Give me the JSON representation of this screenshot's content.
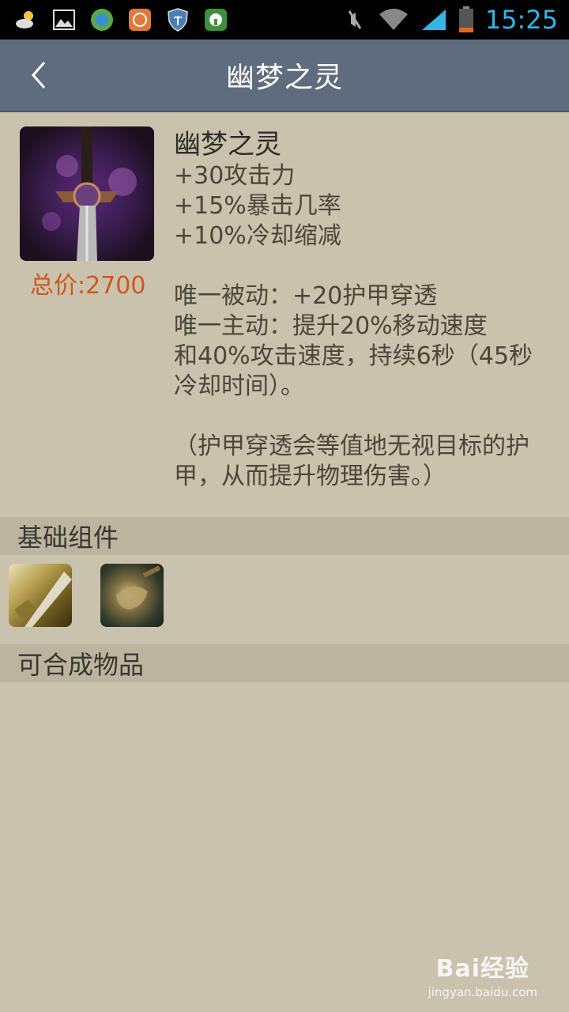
{
  "status_bar": {
    "time": "15:25",
    "icons": [
      "weather-icon",
      "gallery-icon",
      "browser-icon",
      "lock-app-icon",
      "shield-icon",
      "security-app-icon",
      "mute-icon",
      "wifi-icon",
      "signal-icon",
      "battery-icon"
    ]
  },
  "header": {
    "title": "幽梦之灵"
  },
  "item": {
    "name": "幽梦之灵",
    "stats": [
      "+30攻击力",
      "+15%暴击几率",
      "+10%冷却缩减"
    ],
    "passive": "唯一被动：+20护甲穿透",
    "active_lines": [
      "唯一主动：提升20%移动速度",
      "和40%攻击速度，持续6秒（45秒",
      "冷却时间）。"
    ],
    "note_lines": [
      "（护甲穿透会等值地无视目标的护",
      "甲，从而提升物理伤害。）"
    ],
    "price": "总价:2700"
  },
  "sections": {
    "components_label": "基础组件",
    "builds_into_label": "可合成物品"
  },
  "components": [
    "long-sword-icon",
    "brawlers-gloves-icon"
  ],
  "watermark": {
    "main": "Bai经验",
    "sub": "jingyan.baidu.com"
  },
  "colors": {
    "background": "#c9c2ad",
    "title_bar": "#5f6c7d",
    "section_bar": "#bbb49f",
    "price": "#d2561e",
    "clock": "#33b5e5"
  }
}
